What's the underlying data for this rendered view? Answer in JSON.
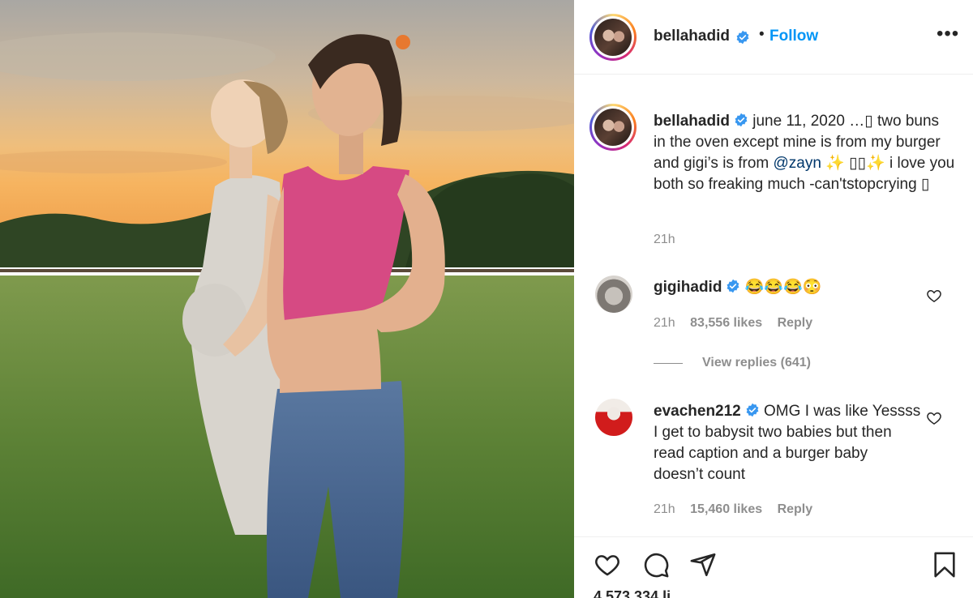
{
  "post": {
    "username": "bellahadid",
    "follow_label": "Follow",
    "separator": "•",
    "more_label": "•••",
    "caption": {
      "username": "bellahadid",
      "text_before_mention": "june 11, 2020 …▯ two buns in the oven except mine is from my burger and gigi’s is from ",
      "mention": "@zayn",
      "text_after_mention": " ✨ ▯▯✨ i love you both so freaking much -can'tstopcrying ▯",
      "time": "21h"
    }
  },
  "comments": [
    {
      "username": "gigihadid",
      "text": "😂😂😂😳",
      "time": "21h",
      "likes": "83,556 likes",
      "reply": "Reply",
      "view_replies": "View replies (641)"
    },
    {
      "username": "evachen212",
      "text": "OMG I was like Yessss I get to babysit two babies but then read caption and a burger baby doesn’t count",
      "time": "21h",
      "likes": "15,460 likes",
      "reply": "Reply"
    }
  ],
  "likes_total": "4,573,334 li",
  "icons": {
    "verified": "verified-badge-icon",
    "heart": "heart-icon",
    "comment": "comment-icon",
    "share": "share-icon",
    "save": "bookmark-icon"
  },
  "colors": {
    "accent": "#0095f6",
    "text": "#262626",
    "muted": "#8e8e8e",
    "mention": "#00376b"
  }
}
